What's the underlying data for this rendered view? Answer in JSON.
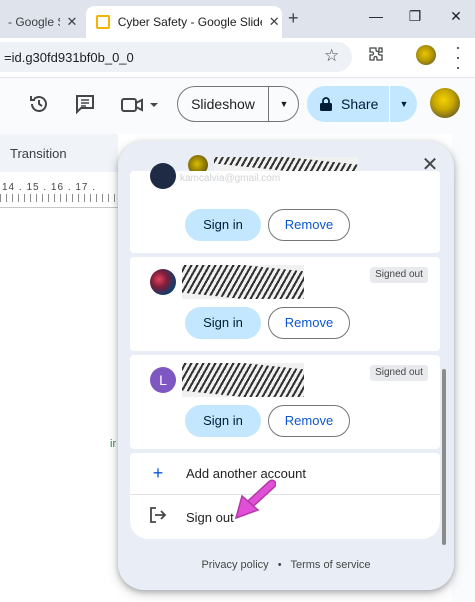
{
  "browser": {
    "tabs": [
      {
        "title": "- Google S",
        "active": false
      },
      {
        "title": "Cyber Safety - Google Slides",
        "active": true
      }
    ],
    "close_glyph": "✕",
    "new_tab_glyph": "+",
    "window_controls": {
      "minimize": "—",
      "restore": "❐",
      "close": "✕"
    },
    "url": "=id.g30fd931bf0b_0_0"
  },
  "toolbar": {
    "slideshow_label": "Slideshow",
    "share_label": "Share",
    "caret": "▼"
  },
  "panel": {
    "transition_label": "Transition",
    "ruler_numbers": "14 . 15 . 16 . 17 ."
  },
  "popup": {
    "close_glyph": "✕",
    "accounts": [
      {
        "email_faint": "kamcalvia@gmail.com",
        "signed_out": false,
        "signin_label": "Sign in",
        "remove_label": "Remove"
      },
      {
        "signed_out": true,
        "badge": "Signed out",
        "signin_label": "Sign in",
        "remove_label": "Remove"
      },
      {
        "avatar_letter": "L",
        "signed_out": true,
        "badge": "Signed out",
        "signin_label": "Sign in",
        "remove_label": "Remove"
      }
    ],
    "add_account_label": "Add another account",
    "sign_out_label": "Sign out",
    "footer": {
      "privacy": "Privacy policy",
      "terms": "Terms of service",
      "separator": "•"
    }
  },
  "colors": {
    "accent": "#0b57d0",
    "share_bg": "#c2e7ff",
    "popup_bg": "#e9eef6",
    "annotation_arrow": "#e04fd6"
  },
  "icons": [
    "slides-favicon",
    "star-icon",
    "extensions-icon",
    "history-icon",
    "comment-icon",
    "video-icon",
    "lock-icon",
    "plus-icon",
    "sign-out-icon",
    "annotation-arrow"
  ]
}
